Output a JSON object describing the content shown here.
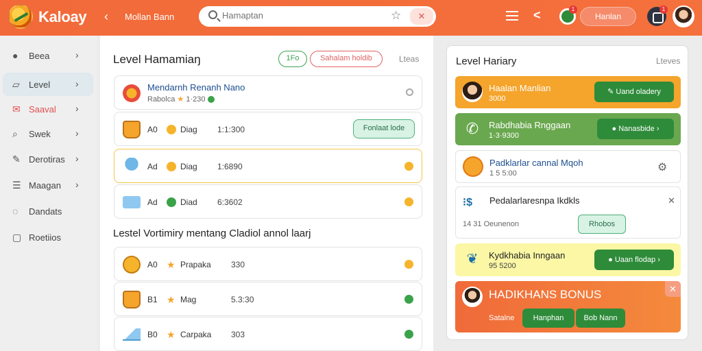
{
  "header": {
    "brand": "Kaloay",
    "breadcrumb": "Mollan Bann",
    "search_placeholder": "Hamaptan",
    "notif_count": "1",
    "button_label": "Hanlan",
    "profile_notif": "1"
  },
  "sidebar": {
    "items": [
      {
        "label": "Beea",
        "icon": "user-icon"
      },
      {
        "label": "Level",
        "icon": "layers-icon"
      },
      {
        "label": "Saaval",
        "icon": "mail-icon"
      },
      {
        "label": "Swek",
        "icon": "search-icon"
      },
      {
        "label": "Derotiras",
        "icon": "pen-icon"
      },
      {
        "label": "Maagan",
        "icon": "list-icon"
      },
      {
        "label": "Dandats",
        "icon": "chat-icon"
      },
      {
        "label": "Roetiios",
        "icon": "file-icon"
      }
    ]
  },
  "main": {
    "title": "Level Hamamiaŋ",
    "pill_green": "1Fo",
    "pill_red": "Sahalam holdib",
    "link": "Lteas",
    "card1": {
      "title": "Mendarnh Renanh Nano",
      "sub_a": "Rabolca",
      "sub_b": "1·230"
    },
    "cards_a": [
      {
        "a": "A0",
        "b": "Diag",
        "c": "1:1:300",
        "button": "Fonlaat lode"
      },
      {
        "a": "Ad",
        "b": "Diag",
        "c": "1:6890"
      },
      {
        "a": "Ad",
        "b": "Diad",
        "c": "6:3602"
      }
    ],
    "section_title": "Lestel Vortimiry mentang Cladiol annol laarj",
    "cards_b": [
      {
        "a": "A0",
        "b": "Prapaka",
        "c": "330"
      },
      {
        "a": "B1",
        "b": "Mag",
        "c": "5.3:30"
      },
      {
        "a": "B0",
        "b": "Carpaka",
        "c": "303"
      }
    ]
  },
  "right": {
    "title": "Level Hariary",
    "link": "Lteves",
    "items": [
      {
        "t1": "Haalan Manlian",
        "t2": "3000",
        "button": "Uand oladery"
      },
      {
        "t1": "Rabdhabia Rnggaan",
        "t2": "1·3·9300",
        "button": "Nanasbide"
      },
      {
        "t1": "Padklarlar cannal Mqoh",
        "t2": "1 5 5:00"
      },
      {
        "t1": "Pedalarlaresnpa Ikdkls",
        "t2": "14 31 Oeunenon",
        "button": "Rhobos"
      },
      {
        "t1": "Kydkhabia Inngaan",
        "t2": "95 5200",
        "button": "Uaan flodap"
      }
    ],
    "bonus": {
      "title": "HADIKHANS BONUS",
      "sub": "Satalne",
      "btn1": "Hanphan",
      "btn2": "Bob Nann"
    }
  },
  "colors": {
    "brand": "#f26a3a",
    "green": "#3aa34a",
    "orange": "#f5a42c"
  }
}
